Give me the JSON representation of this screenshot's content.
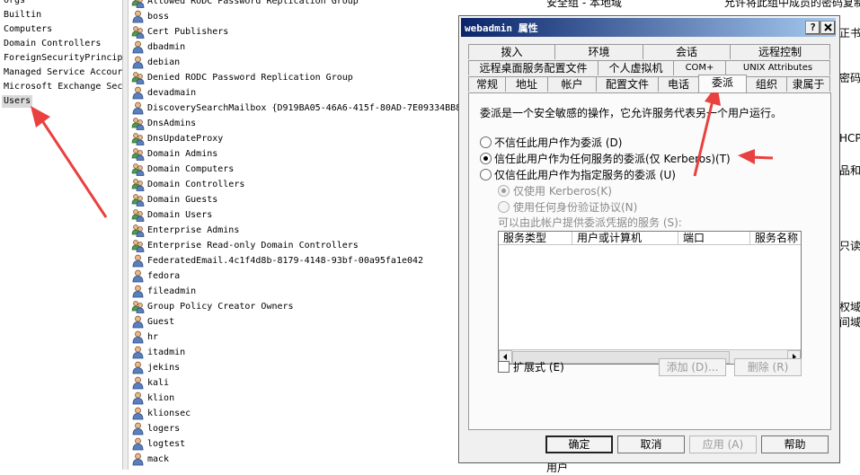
{
  "tree": {
    "items": [
      "Orgs",
      "Builtin",
      "Computers",
      "Domain Controllers",
      "ForeignSecurityPrincip",
      "Managed Service Accour",
      "Microsoft Exchange Sec",
      "Users"
    ],
    "selected_index": 7
  },
  "objects": {
    "rows": [
      {
        "name": "Allowed RODC Password Replication Group",
        "icon": "group-icon"
      },
      {
        "name": "boss",
        "icon": "user-icon"
      },
      {
        "name": "Cert Publishers",
        "icon": "group-icon"
      },
      {
        "name": "dbadmin",
        "icon": "user-icon"
      },
      {
        "name": "debian",
        "icon": "user-icon"
      },
      {
        "name": "Denied RODC Password Replication Group",
        "icon": "group-icon"
      },
      {
        "name": "devadmain",
        "icon": "user-icon"
      },
      {
        "name": "DiscoverySearchMailbox {D919BA05-46A6-415f-80AD-7E09334BB8",
        "icon": "user-icon"
      },
      {
        "name": "DnsAdmins",
        "icon": "group-icon"
      },
      {
        "name": "DnsUpdateProxy",
        "icon": "group-icon"
      },
      {
        "name": "Domain Admins",
        "icon": "group-icon"
      },
      {
        "name": "Domain Computers",
        "icon": "group-icon"
      },
      {
        "name": "Domain Controllers",
        "icon": "group-icon"
      },
      {
        "name": "Domain Guests",
        "icon": "group-icon"
      },
      {
        "name": "Domain Users",
        "icon": "group-icon"
      },
      {
        "name": "Enterprise Admins",
        "icon": "group-icon"
      },
      {
        "name": "Enterprise Read-only Domain Controllers",
        "icon": "group-icon"
      },
      {
        "name": "FederatedEmail.4c1f4d8b-8179-4148-93bf-00a95fa1e042",
        "icon": "user-icon"
      },
      {
        "name": "fedora",
        "icon": "user-icon"
      },
      {
        "name": "fileadmin",
        "icon": "user-icon"
      },
      {
        "name": "Group Policy Creator Owners",
        "icon": "group-icon"
      },
      {
        "name": "Guest",
        "icon": "user-icon"
      },
      {
        "name": "hr",
        "icon": "user-icon"
      },
      {
        "name": "itadmin",
        "icon": "user-icon"
      },
      {
        "name": "jekins",
        "icon": "user-icon"
      },
      {
        "name": "kali",
        "icon": "user-icon"
      },
      {
        "name": "klion",
        "icon": "user-icon"
      },
      {
        "name": "klionsec",
        "icon": "user-icon"
      },
      {
        "name": "logers",
        "icon": "user-icon"
      },
      {
        "name": "logtest",
        "icon": "user-icon"
      },
      {
        "name": "mack",
        "icon": "user-icon"
      }
    ]
  },
  "background_text": {
    "top_a": "安全组 - 本地域",
    "top_b": "允许将此组中成员的密码复制",
    "r1": "正书到",
    "r2": "密码复",
    "r3": "HCP",
    "r4": "品和服",
    "r5": "只读域",
    "r6": "权域的",
    "r7": "间域的",
    "mid1": "用户"
  },
  "dialog": {
    "title": "webadmin 属性",
    "help_btn": "?",
    "close_btn": "X",
    "tabs_row1": [
      "拨入",
      "环境",
      "会话",
      "远程控制"
    ],
    "tabs_row2": [
      "远程桌面服务配置文件",
      "个人虚拟机",
      "COM+",
      "UNIX Attributes"
    ],
    "tabs_row3": [
      "常规",
      "地址",
      "帐户",
      "配置文件",
      "电话",
      "委派",
      "组织",
      "隶属于"
    ],
    "active_tab": "委派",
    "description": "委派是一个安全敏感的操作，它允许服务代表另一个用户运行。",
    "options": {
      "no_trust": "不信任此用户作为委派 (D)",
      "trust_any": "信任此用户作为任何服务的委派(仅 Kerberos)(T)",
      "trust_specified": "仅信任此用户作为指定服务的委派 (U)",
      "kerberos_only": "仅使用 Kerberos(K)",
      "any_protocol": "使用任何身份验证协议(N)",
      "services_label": "可以由此帐户提供委派凭据的服务 (S):"
    },
    "selected_option": "trust_any",
    "table_headers": [
      "服务类型",
      "用户或计算机",
      "端口",
      "服务名称"
    ],
    "expanded_label": "扩展式 (E)",
    "add_button": "添加 (D)...",
    "remove_button": "删除 (R)",
    "ok_button": "确定",
    "cancel_button": "取消",
    "apply_button": "应用 (A)",
    "help_button": "帮助"
  },
  "colors": {
    "arrow": "#e8413f",
    "titlebar_start": "#0a246a",
    "titlebar_end": "#a6caf0"
  }
}
